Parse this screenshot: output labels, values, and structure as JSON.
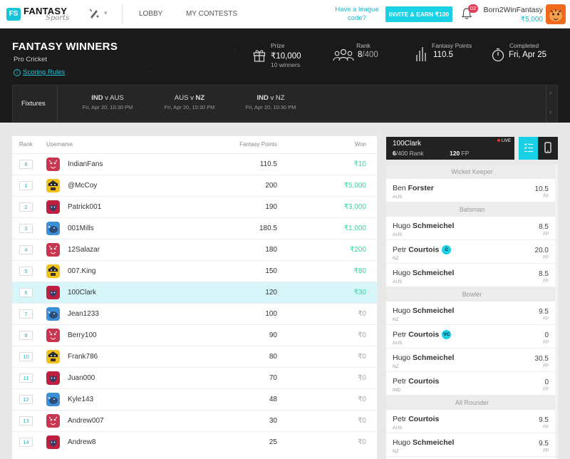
{
  "nav": {
    "logo_mark": "FS",
    "logo_title": "FANTASY",
    "logo_sub": "Sports",
    "sport_icon": "cricket-bat-icon",
    "links": [
      "LOBBY",
      "MY CONTESTS"
    ],
    "league_question": "Have a league code?",
    "invite_label": "INVITE & EARN ₹100",
    "notif_count": "02",
    "username": "Born2WinFantasy",
    "balance": "₹5,000",
    "avatar_icon": "tiger-avatar-icon"
  },
  "contest": {
    "title": "FANTASY WINNERS",
    "subtitle": "Pro Cricket",
    "rules_link": "Scoring Rules",
    "prize_label": "Prize",
    "prize_value": "₹10,000",
    "prize_winners": "10 winners",
    "rank_label": "Rank",
    "rank_value": "8",
    "rank_total": "/400",
    "points_label": "Fantasy Points",
    "points_value": "110.5",
    "status_label": "Completed",
    "status_value": "Fri, Apr 25"
  },
  "fixtures": {
    "label": "Fixtures",
    "matches": [
      {
        "team1": "IND",
        "v": "v",
        "team2": "AUS",
        "bold": "team1",
        "date": "Fri, Apr 20, 10:30 PM"
      },
      {
        "team1": "AUS",
        "v": "v",
        "team2": "NZ",
        "bold": "team2",
        "date": "Fri, Apr 20, 10:30 PM"
      },
      {
        "team1": "IND",
        "v": "v",
        "team2": "NZ",
        "bold": "team1",
        "date": "Fri, Apr 20, 10:30 PM"
      }
    ]
  },
  "leaderboard": {
    "columns": {
      "rank": "Rank",
      "username": "Username",
      "points": "Fantasy Points",
      "won": "Won"
    },
    "rows": [
      {
        "rank": "8",
        "username": "IndianFans",
        "points": "110.5",
        "won": "₹10",
        "avatar": "tiger",
        "me": false
      },
      {
        "rank": "1",
        "username": "@McCoy",
        "points": "200",
        "won": "₹5,000",
        "avatar": "thief",
        "me": false
      },
      {
        "rank": "2",
        "username": "Patrick001",
        "points": "190",
        "won": "₹3,000",
        "avatar": "wolf",
        "me": false
      },
      {
        "rank": "3",
        "username": "001Mills",
        "points": "180.5",
        "won": "₹1,000",
        "avatar": "rhino",
        "me": false
      },
      {
        "rank": "4",
        "username": "12Salazar",
        "points": "180",
        "won": "₹200",
        "avatar": "tiger",
        "me": false
      },
      {
        "rank": "5",
        "username": "007.King",
        "points": "150",
        "won": "₹80",
        "avatar": "thief",
        "me": false
      },
      {
        "rank": "6",
        "username": "100Clark",
        "points": "120",
        "won": "₹30",
        "avatar": "wolf",
        "me": true
      },
      {
        "rank": "7",
        "username": "Jean1233",
        "points": "100",
        "won": "₹0",
        "avatar": "rhino",
        "me": false
      },
      {
        "rank": "9",
        "username": "Berry100",
        "points": "90",
        "won": "₹0",
        "avatar": "tiger",
        "me": false
      },
      {
        "rank": "10",
        "username": "Frank786",
        "points": "80",
        "won": "₹0",
        "avatar": "thief",
        "me": false
      },
      {
        "rank": "11",
        "username": "Juan000",
        "points": "70",
        "won": "₹0",
        "avatar": "wolf",
        "me": false
      },
      {
        "rank": "12",
        "username": "Kyle143",
        "points": "48",
        "won": "₹0",
        "avatar": "rhino",
        "me": false
      },
      {
        "rank": "13",
        "username": "Andrew007",
        "points": "30",
        "won": "₹0",
        "avatar": "tiger",
        "me": false
      },
      {
        "rank": "14",
        "username": "Andrew8",
        "points": "25",
        "won": "₹0",
        "avatar": "wolf",
        "me": false
      }
    ]
  },
  "my_team": {
    "name": "100Clark",
    "rank": "6",
    "rank_suffix": "/400 Rank",
    "fp": "120",
    "fp_suffix": " FP",
    "live": "LIVE",
    "view_icons": [
      "list-view-icon",
      "phone-view-icon"
    ],
    "sections": [
      {
        "title": "Wicket Keeper",
        "players": [
          {
            "first": "Ben",
            "last": "Forster",
            "team": "AUS",
            "points": "10.5",
            "badge": ""
          }
        ]
      },
      {
        "title": "Batsman",
        "players": [
          {
            "first": "Hugo",
            "last": "Schmeichel",
            "team": "AUS",
            "points": "8.5",
            "badge": ""
          },
          {
            "first": "Petr",
            "last": "Courtois",
            "team": "NZ",
            "points": "20.0",
            "badge": "C"
          },
          {
            "first": "Hugo",
            "last": "Schmeichel",
            "team": "AUS",
            "points": "8.5",
            "badge": ""
          }
        ]
      },
      {
        "title": "Bowler",
        "players": [
          {
            "first": "Hugo",
            "last": "Schmeichel",
            "team": "NZ",
            "points": "9.5",
            "badge": ""
          },
          {
            "first": "Petr",
            "last": "Courtois",
            "team": "AUS",
            "points": "0",
            "badge": "VC"
          },
          {
            "first": "Hugo",
            "last": "Schmeichel",
            "team": "NZ",
            "points": "30.5",
            "badge": ""
          },
          {
            "first": "Petr",
            "last": "Courtois",
            "team": "IND",
            "points": "0",
            "badge": ""
          }
        ]
      },
      {
        "title": "All Rounder",
        "players": [
          {
            "first": "Petr",
            "last": "Courtois",
            "team": "AUS",
            "points": "9.5",
            "badge": ""
          },
          {
            "first": "Hugo",
            "last": "Schmeichel",
            "team": "NZ",
            "points": "9.5",
            "badge": ""
          }
        ]
      }
    ],
    "fp_label": "FP"
  },
  "colors": {
    "accent": "#1ad0e4",
    "win_green": "#2bd9a0",
    "zero": "#aaaaaa",
    "highlight": "#d6f6f9",
    "tiger": "#c9344f",
    "thief": "#f3c21a",
    "wolf": "#c21f3f",
    "rhino": "#3b8fd6"
  }
}
